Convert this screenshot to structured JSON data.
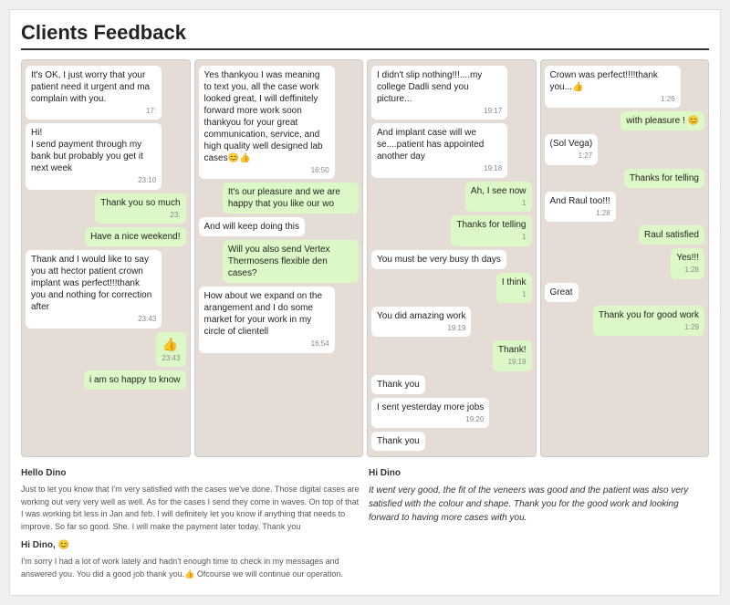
{
  "title": "Clients Feedback",
  "chat1": {
    "messages": [
      {
        "type": "received",
        "text": "It's OK, I just worry that your patient need it urgent and ma complain with you.",
        "time": "17:"
      },
      {
        "type": "received",
        "text": "Hi!\nI send payment through my bank but probably you get it next week",
        "time": "23:10"
      },
      {
        "type": "sent",
        "text": "Thank you so much",
        "time": "23:"
      },
      {
        "type": "sent",
        "text": "Have a nice weekend!",
        "time": ""
      },
      {
        "type": "received",
        "text": "Thank and I would like to say you att hector patient crown implant was perfect!!!thank you and nothing for correction after",
        "time": "23:43"
      },
      {
        "type": "sent",
        "text": "👍",
        "time": "23:43"
      },
      {
        "type": "sent",
        "text": "i am so happy to know",
        "time": ""
      }
    ]
  },
  "chat2": {
    "messages": [
      {
        "type": "sent",
        "text": "Yes thankyou I was meaning to text you, all the case work looked great, I will deffinitely forward more work soon thankyou for your great communication, service, and high quality well designed lab cases😊👍",
        "time": "16:50"
      },
      {
        "type": "received",
        "text": "It's our pleasure and we are happy that you like our wo",
        "time": ""
      },
      {
        "type": "sent",
        "text": "And will keep doing this",
        "time": ""
      },
      {
        "type": "received",
        "text": "Will you also send Vertex Thermosens flexible den cases?",
        "time": ""
      },
      {
        "type": "received",
        "text": "How about we expand on the arangement and I do some market for your work in my circle of clientell",
        "time": "16:54"
      }
    ]
  },
  "chat3": {
    "messages": [
      {
        "type": "received",
        "text": "I didn't slip nothing!!!....my college Dadli send you picture...",
        "time": "19:17"
      },
      {
        "type": "received",
        "text": "And implant case will we se....patient has appointed another day",
        "time": "19:18"
      },
      {
        "type": "sent",
        "text": "Ah, I see now",
        "time": "1"
      },
      {
        "type": "sent",
        "text": "Thanks for telling",
        "time": "1"
      },
      {
        "type": "received",
        "text": "You must be very busy th days",
        "time": ""
      },
      {
        "type": "sent",
        "text": "I think",
        "time": "1"
      },
      {
        "type": "received",
        "text": "You did amazing work",
        "time": "19:19"
      },
      {
        "type": "sent",
        "text": "Thank!",
        "time": "19:19"
      },
      {
        "type": "received",
        "text": "Thank you",
        "time": ""
      },
      {
        "type": "received",
        "text": "I sent yesterday more jobs",
        "time": "19:20"
      },
      {
        "type": "received",
        "text": "Thank you",
        "time": ""
      }
    ]
  },
  "chat4": {
    "messages": [
      {
        "type": "received",
        "text": "Crown was perfect!!!!thank you...👍",
        "time": "1:26"
      },
      {
        "type": "sent",
        "text": "with pleasure ! 😊",
        "time": ""
      },
      {
        "type": "received",
        "text": "(Sol Vega)",
        "time": "1:27"
      },
      {
        "type": "sent",
        "text": "Thanks for telling",
        "time": ""
      },
      {
        "type": "received",
        "text": "And Raul too!!!",
        "time": "1:28"
      },
      {
        "type": "sent",
        "text": "Raul satisfied",
        "time": ""
      },
      {
        "type": "sent",
        "text": "Yes!!!",
        "time": "1:28"
      },
      {
        "type": "received",
        "text": "Great",
        "time": ""
      },
      {
        "type": "sent",
        "text": "Thank you for good work",
        "time": "1:29"
      }
    ]
  },
  "bottom": {
    "left": {
      "sender": "Hello Dino",
      "text": "Just to let you know that I'm very satisfied with the cases we've done. Those digital cases are working out very very well as well. As for the cases I send they come in waves. On top of that I was working bit less in Jan and feb. I will definitely let you know if anything that needs to improve. So far so good.\nShe. I will make the payment later today.\nThank you",
      "sender2": "Hi Dino, 😊",
      "text2": "I'm sorry I had a lot of work lately and hadn't enough time to check in my messages and answered you.\nYou did a good job thank you.👍\nOfcourse we will continue our operation."
    },
    "right": {
      "sender": "Hi Dino",
      "text": "It went very good, the fit of the veneers was good and the patient was also very satisfied with the colour and shape. Thank you for the good work and looking forward to having more cases with you."
    }
  }
}
